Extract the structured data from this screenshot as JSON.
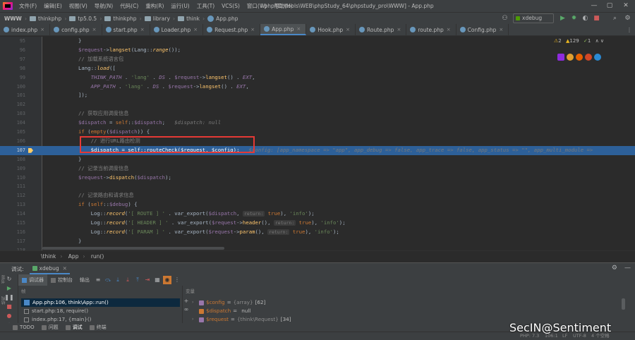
{
  "menubar": {
    "items": [
      "文件(F)",
      "编辑(E)",
      "视图(V)",
      "导航(N)",
      "代码(C)",
      "重构(R)",
      "运行(U)",
      "工具(T)",
      "VCS(S)",
      "窗口(W)",
      "帮助(H)"
    ],
    "window_title": "l.php [D:\\tools\\WEB\\phpStudy_64\\phpstudy_pro\\WWW] - App.php",
    "controls": [
      "—",
      "▢",
      "✕"
    ]
  },
  "navbar": {
    "crumbs": [
      "WWW",
      "thinkphp",
      "tp5.0.5",
      "thinkphp",
      "library",
      "think",
      "App.php"
    ],
    "run_config": "xdebug"
  },
  "tabs": [
    {
      "label": "index.php",
      "active": false
    },
    {
      "label": "config.php",
      "active": false
    },
    {
      "label": "start.php",
      "active": false
    },
    {
      "label": "Loader.php",
      "active": false
    },
    {
      "label": "Request.php",
      "active": false
    },
    {
      "label": "App.php",
      "active": true
    },
    {
      "label": "Hook.php",
      "active": false
    },
    {
      "label": "Route.php",
      "active": false
    },
    {
      "label": "route.php",
      "active": false
    },
    {
      "label": "Config.php",
      "active": false
    }
  ],
  "problems": {
    "warnings": "2",
    "weak_warnings": "129",
    "ok": "1"
  },
  "editor": {
    "lines": [
      {
        "n": "95",
        "html": "}"
      },
      {
        "n": "96",
        "parts": [
          [
            "var",
            "$request"
          ],
          [
            "",
            "->"
          ],
          [
            "fn",
            "langset"
          ],
          [
            "",
            "("
          ],
          [
            "cls",
            "Lang"
          ],
          [
            "",
            "::"
          ],
          [
            "static",
            "range"
          ],
          [
            "",
            "());"
          ]
        ]
      },
      {
        "n": "97",
        "parts": [
          [
            "cmt",
            "// 加载系统语言包"
          ]
        ]
      },
      {
        "n": "98",
        "parts": [
          [
            "cls",
            "Lang"
          ],
          [
            "",
            "::"
          ],
          [
            "static",
            "load"
          ],
          [
            "",
            "(["
          ]
        ]
      },
      {
        "n": "99",
        "parts": [
          [
            "",
            "    "
          ],
          [
            "const",
            "THINK_PATH"
          ],
          [
            "",
            " . "
          ],
          [
            "str",
            "'lang'"
          ],
          [
            "",
            " . "
          ],
          [
            "const",
            "DS"
          ],
          [
            "",
            " . "
          ],
          [
            "var",
            "$request"
          ],
          [
            "",
            "->"
          ],
          [
            "fn",
            "langset"
          ],
          [
            "",
            "() . "
          ],
          [
            "const",
            "EXT"
          ],
          [
            "",
            ","
          ]
        ]
      },
      {
        "n": "100",
        "parts": [
          [
            "",
            "    "
          ],
          [
            "const",
            "APP_PATH"
          ],
          [
            "",
            " . "
          ],
          [
            "str",
            "'lang'"
          ],
          [
            "",
            " . "
          ],
          [
            "const",
            "DS"
          ],
          [
            "",
            " . "
          ],
          [
            "var",
            "$request"
          ],
          [
            "",
            "->"
          ],
          [
            "fn",
            "langset"
          ],
          [
            "",
            "() . "
          ],
          [
            "const",
            "EXT"
          ],
          [
            "",
            ","
          ]
        ]
      },
      {
        "n": "101",
        "parts": [
          [
            "",
            "]);"
          ]
        ]
      },
      {
        "n": "102",
        "parts": [
          [
            "",
            ""
          ]
        ]
      },
      {
        "n": "103",
        "parts": [
          [
            "cmt",
            "// 获取应用调度信息"
          ]
        ]
      },
      {
        "n": "104",
        "parts": [
          [
            "var",
            "$dispatch"
          ],
          [
            "",
            " = "
          ],
          [
            "kw",
            "self"
          ],
          [
            "",
            "::"
          ],
          [
            "var",
            "$dispatch"
          ],
          [
            "",
            ";   "
          ],
          [
            "inl",
            "$dispatch: null"
          ]
        ]
      },
      {
        "n": "105",
        "parts": [
          [
            "kw",
            "if"
          ],
          [
            "",
            " ("
          ],
          [
            "kw",
            "empty"
          ],
          [
            "",
            "("
          ],
          [
            "var",
            "$dispatch"
          ],
          [
            "",
            ")) {"
          ]
        ]
      },
      {
        "n": "106",
        "parts": [
          [
            "",
            "    "
          ],
          [
            "cmt",
            "// 进行URL路由检测"
          ]
        ]
      },
      {
        "n": "107",
        "exec": true,
        "parts": [
          [
            "",
            "    $dispatch = self::"
          ],
          [
            "",
            "routeCheck"
          ],
          [
            "",
            "($request, $config);   "
          ],
          [
            "inl",
            "$config: [app_namespace => \"app\", app_debug => false, app_trace => false, app_status => \"\", app_multi_module =>"
          ]
        ]
      },
      {
        "n": "108",
        "parts": [
          [
            "",
            "}"
          ]
        ]
      },
      {
        "n": "109",
        "parts": [
          [
            "cmt",
            "// 记录当前调度信息"
          ]
        ]
      },
      {
        "n": "110",
        "parts": [
          [
            "var",
            "$request"
          ],
          [
            "",
            "->"
          ],
          [
            "fn",
            "dispatch"
          ],
          [
            "",
            "("
          ],
          [
            "var",
            "$dispatch"
          ],
          [
            "",
            ");"
          ]
        ]
      },
      {
        "n": "111",
        "parts": [
          [
            "",
            ""
          ]
        ]
      },
      {
        "n": "112",
        "parts": [
          [
            "cmt",
            "// 记录路由和请求信息"
          ]
        ]
      },
      {
        "n": "113",
        "parts": [
          [
            "kw",
            "if"
          ],
          [
            "",
            " ("
          ],
          [
            "kw",
            "self"
          ],
          [
            "",
            "::"
          ],
          [
            "var",
            "$debug"
          ],
          [
            "",
            ") {"
          ]
        ]
      },
      {
        "n": "114",
        "parts": [
          [
            "",
            "    "
          ],
          [
            "cls",
            "Log"
          ],
          [
            "",
            "::"
          ],
          [
            "static",
            "record"
          ],
          [
            "",
            "("
          ],
          [
            "str",
            "'[ ROUTE ] '"
          ],
          [
            "",
            " . var_export("
          ],
          [
            "var",
            "$dispatch"
          ],
          [
            "",
            ", "
          ],
          [
            "hint",
            "return:"
          ],
          [
            "",
            " "
          ],
          [
            "kw",
            "true"
          ],
          [
            "",
            "), "
          ],
          [
            "str",
            "'info'"
          ],
          [
            "",
            ");"
          ]
        ]
      },
      {
        "n": "115",
        "parts": [
          [
            "",
            "    "
          ],
          [
            "cls",
            "Log"
          ],
          [
            "",
            "::"
          ],
          [
            "static",
            "record"
          ],
          [
            "",
            "("
          ],
          [
            "str",
            "'[ HEADER ] '"
          ],
          [
            "",
            " . var_export("
          ],
          [
            "var",
            "$request"
          ],
          [
            "",
            "->"
          ],
          [
            "fn",
            "header"
          ],
          [
            "",
            "(), "
          ],
          [
            "hint",
            "return:"
          ],
          [
            "",
            " "
          ],
          [
            "kw",
            "true"
          ],
          [
            "",
            "), "
          ],
          [
            "str",
            "'info'"
          ],
          [
            "",
            ");"
          ]
        ]
      },
      {
        "n": "116",
        "parts": [
          [
            "",
            "    "
          ],
          [
            "cls",
            "Log"
          ],
          [
            "",
            "::"
          ],
          [
            "static",
            "record"
          ],
          [
            "",
            "("
          ],
          [
            "str",
            "'[ PARAM ] '"
          ],
          [
            "",
            " . var_export("
          ],
          [
            "var",
            "$request"
          ],
          [
            "",
            "->"
          ],
          [
            "fn",
            "param"
          ],
          [
            "",
            "(), "
          ],
          [
            "hint",
            "return:"
          ],
          [
            "",
            " "
          ],
          [
            "kw",
            "true"
          ],
          [
            "",
            "), "
          ],
          [
            "str",
            "'info'"
          ],
          [
            "",
            ");"
          ]
        ]
      },
      {
        "n": "117",
        "parts": [
          [
            "",
            "}"
          ]
        ]
      },
      {
        "n": "118",
        "parts": [
          [
            "",
            ""
          ]
        ]
      },
      {
        "n": "119",
        "parts": [
          [
            "",
            ""
          ]
        ]
      }
    ]
  },
  "breadcrumb": [
    "\\think",
    "App",
    "run()"
  ],
  "debug": {
    "label": "调试:",
    "session": "xdebug",
    "toolbar_tabs": [
      "调试器",
      "控制台",
      "输出"
    ],
    "frames_header": "帧",
    "variables_header": "变量",
    "frames": [
      {
        "text": "App.php:106, think\\App::run()",
        "selected": true
      },
      {
        "text": "start.php:18, require()",
        "selected": false
      },
      {
        "text": "index.php:17, {main}()",
        "selected": false
      }
    ],
    "variables": [
      {
        "name": "$config",
        "eq": "=",
        "type": "{array}",
        "value": "[62]",
        "expandable": true,
        "icon": "#9876aa"
      },
      {
        "name": "$dispatch",
        "eq": "=",
        "type": "",
        "value": "null",
        "expandable": false,
        "icon": "#cc7832"
      },
      {
        "name": "$request",
        "eq": "=",
        "type": "{think\\Request}",
        "value": "[34]",
        "expandable": true,
        "icon": "#9876aa"
      }
    ]
  },
  "bottom_tools": [
    {
      "label": "TODO",
      "active": false
    },
    {
      "label": "问题",
      "active": false
    },
    {
      "label": "调试",
      "active": true
    },
    {
      "label": "终端",
      "active": false
    }
  ],
  "statusbar": {
    "php": "PHP: 7.3",
    "pos": "106:1",
    "eol": "LF",
    "enc": "UTF-8",
    "indent": "4 个空格"
  },
  "watermark": "SecIN@Sentiment"
}
